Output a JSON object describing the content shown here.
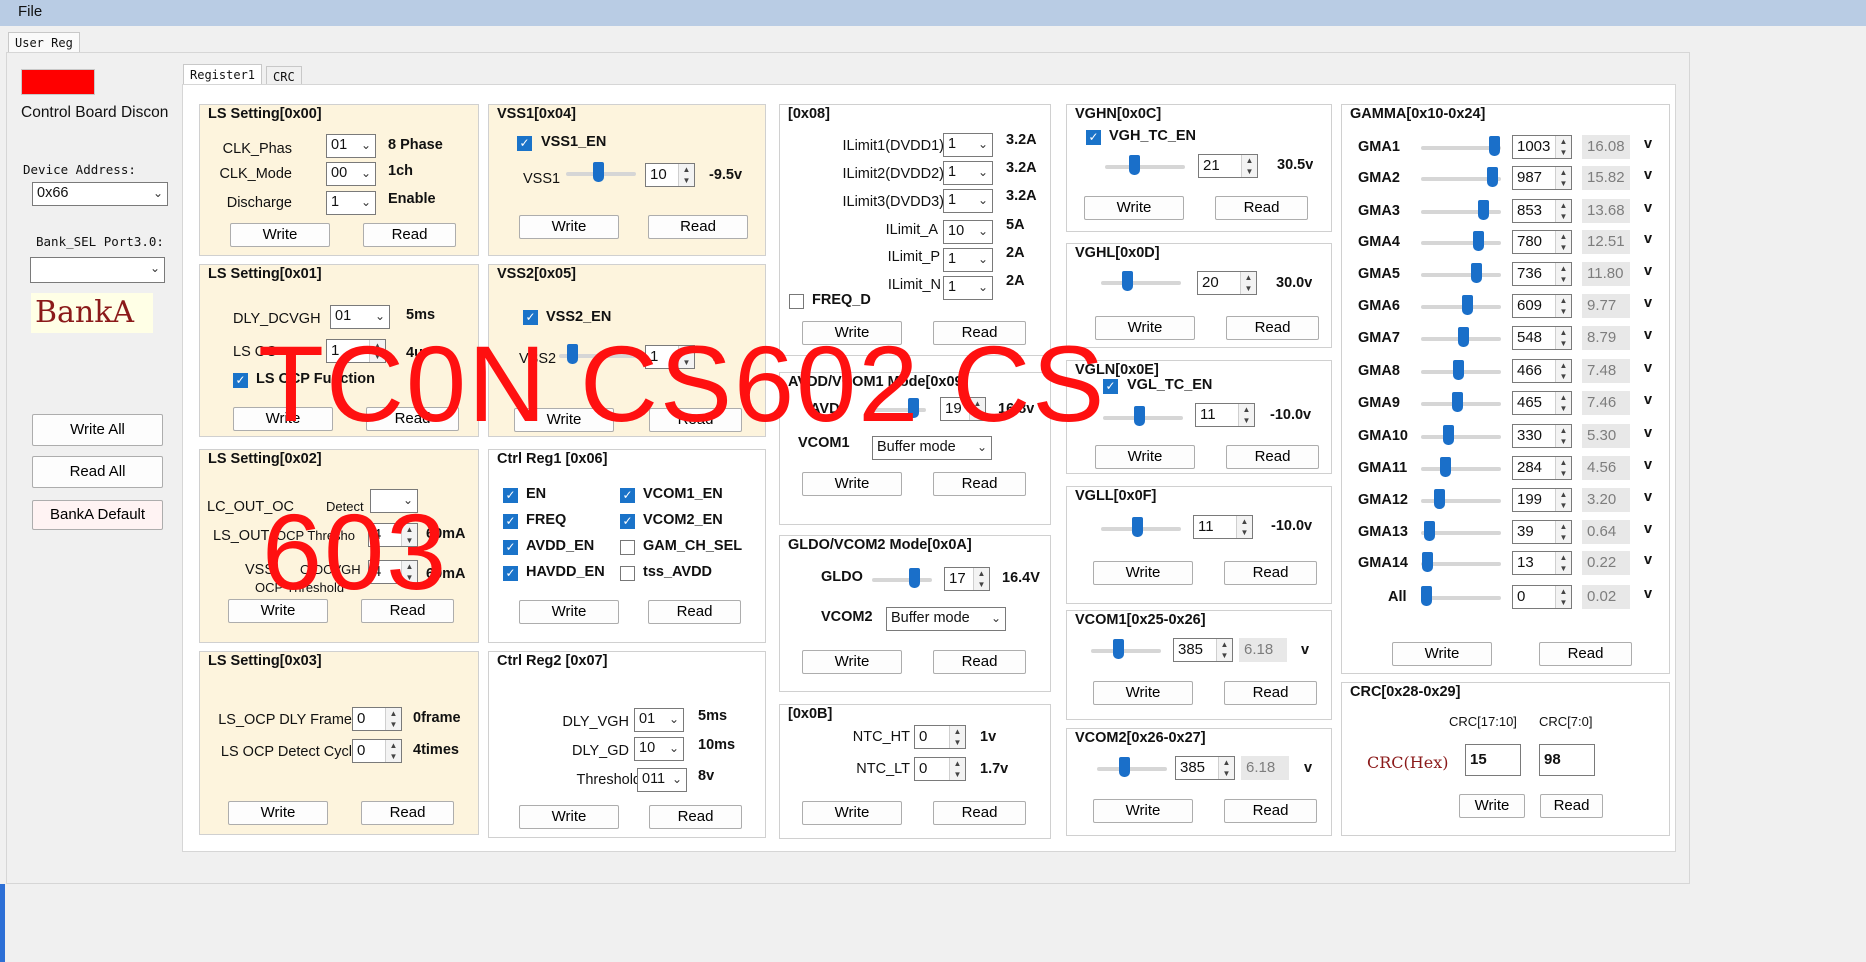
{
  "menu": {
    "file": "File"
  },
  "window": {
    "user_reg_tab": "User Reg",
    "tab_register1": "Register1",
    "tab_crc": "CRC"
  },
  "sidebar": {
    "status_text": "Control Board Discon",
    "status_color": "#ff0000",
    "device_address_label": "Device Address:",
    "device_address_value": "0x66",
    "bank_sel_label": "Bank_SEL Port3.0:",
    "bank_sel_value": "",
    "bank_name": "BankA",
    "write_all": "Write All",
    "read_all": "Read All",
    "bank_default": "BankA Default"
  },
  "buttons": {
    "write": "Write",
    "read": "Read"
  },
  "ls00": {
    "title": "LS Setting[0x00]",
    "rows": [
      {
        "label": "CLK_Phas",
        "value": "01",
        "result": "8 Phase"
      },
      {
        "label": "CLK_Mode",
        "value": "00",
        "result": "1ch"
      },
      {
        "label": "Discharge",
        "value": "1",
        "result": "Enable"
      }
    ]
  },
  "ls01": {
    "title": "LS Setting[0x01]",
    "dly_label": "DLY_DCVGH",
    "dly_value": "01",
    "dly_result": "5ms",
    "ocp_label": "LS OC",
    "ocp_value": "1",
    "ocp_result": "4u",
    "func_label": "LS OCP Function",
    "func_checked": true
  },
  "ls02": {
    "title": "LS Setting[0x02]",
    "lc_label": "LC_OUT_OC",
    "lc_label2": "Detect",
    "lc_value": "",
    "thr_label": "LS_OUT",
    "thr_label2": "OCP Thresho",
    "thr_value": "4",
    "thr_result": "60mA",
    "vss_label": "VSS",
    "vss_label2": "O/DCVGH",
    "vss_label3": "OCP Threshold",
    "vss_value": "4",
    "vss_result": "60mA"
  },
  "ls03": {
    "title": "LS Setting[0x03]",
    "rows": [
      {
        "label": "LS_OCP DLY Frame",
        "value": "0",
        "result": "0frame"
      },
      {
        "label": "LS OCP Detect Cycl",
        "value": "0",
        "result": "4times"
      }
    ]
  },
  "vss1": {
    "title": "VSS1[0x04]",
    "en_label": "VSS1_EN",
    "en_checked": true,
    "slider_label": "VSS1",
    "slider_fraction": 0.45,
    "value": "10",
    "result": "-9.5v"
  },
  "vss2": {
    "title": "VSS2[0x05]",
    "en_label": "VSS2_EN",
    "en_checked": true,
    "slider_label": "VSS2",
    "slider_fraction": 0.1,
    "value": "1",
    "result": "v"
  },
  "ctrl1": {
    "title": "Ctrl Reg1 [0x06]",
    "checks": [
      {
        "label": "EN",
        "checked": true
      },
      {
        "label": "VCOM1_EN",
        "checked": true
      },
      {
        "label": "FREQ",
        "checked": true
      },
      {
        "label": "VCOM2_EN",
        "checked": true
      },
      {
        "label": "AVDD_EN",
        "checked": true
      },
      {
        "label": "GAM_CH_SEL",
        "checked": false
      },
      {
        "label": "HAVDD_EN",
        "checked": true
      },
      {
        "label": "tss_AVDD",
        "checked": false
      }
    ]
  },
  "ctrl2": {
    "title": "Ctrl Reg2 [0x07]",
    "rows": [
      {
        "label": "DLY_VGH",
        "value": "01",
        "result": "5ms"
      },
      {
        "label": "DLY_GD",
        "value": "10",
        "result": "10ms"
      },
      {
        "label": "Threshold",
        "value": "011",
        "result": "8v"
      }
    ]
  },
  "r08": {
    "title": "[0x08]",
    "rows": [
      {
        "label": "ILimit1(DVDD1)",
        "value": "1",
        "result": "3.2A"
      },
      {
        "label": "ILimit2(DVDD2)",
        "value": "1",
        "result": "3.2A"
      },
      {
        "label": "ILimit3(DVDD3)",
        "value": "1",
        "result": "3.2A"
      },
      {
        "label": "ILimit_A",
        "value": "10",
        "result": "5A"
      },
      {
        "label": "ILimit_P",
        "value": "1",
        "result": "2A"
      },
      {
        "label": "ILimit_N",
        "value": "1",
        "result": "2A"
      }
    ],
    "freq_label": "FREQ_D",
    "freq_checked": false
  },
  "r09": {
    "title": "AVDD/VCOM1 Mode[0x09]",
    "avdd_label": "AVD",
    "avdd_value": "19",
    "avdd_result": "16.8v",
    "avdd_fraction": 0.85,
    "vcom_label": "VCOM1",
    "vcom_value": "Buffer mode"
  },
  "r0a": {
    "title": "GLDO/VCOM2 Mode[0x0A]",
    "gldo_label": "GLDO",
    "gldo_value": "17",
    "gldo_result": "16.4V",
    "gldo_fraction": 0.75,
    "vcom_label": "VCOM2",
    "vcom_value": "Buffer mode"
  },
  "r0b": {
    "title": "[0x0B]",
    "rows": [
      {
        "label": "NTC_HT",
        "value": "0",
        "result": "1v"
      },
      {
        "label": "NTC_LT",
        "value": "0",
        "result": "1.7v"
      }
    ]
  },
  "vghn": {
    "title": "VGHN[0x0C]",
    "en_label": "VGH_TC_EN",
    "en_checked": true,
    "value": "21",
    "result": "30.5v",
    "fraction": 0.35
  },
  "vghl": {
    "title": "VGHL[0x0D]",
    "value": "20",
    "result": "30.0v",
    "fraction": 0.3
  },
  "vgln": {
    "title": "VGLN[0x0E]",
    "en_label": "VGL_TC_EN",
    "en_checked": true,
    "value": "11",
    "result": "-10.0v",
    "fraction": 0.45
  },
  "vgll": {
    "title": "VGLL[0x0F]",
    "value": "11",
    "result": "-10.0v",
    "fraction": 0.45
  },
  "vcom1": {
    "title": "VCOM1[0x25-0x26]",
    "value": "385",
    "readout": "6.18",
    "unit": "v",
    "fraction": 0.38
  },
  "vcom2": {
    "title": "VCOM2[0x26-0x27]",
    "value": "385",
    "readout": "6.18",
    "unit": "v",
    "fraction": 0.38
  },
  "gamma": {
    "title": "GAMMA[0x10-0x24]",
    "unit": "v",
    "rows": [
      {
        "label": "GMA1",
        "value": "1003",
        "volts": "16.08",
        "fraction": 0.98
      },
      {
        "label": "GMA2",
        "value": "987",
        "volts": "15.82",
        "fraction": 0.96
      },
      {
        "label": "GMA3",
        "value": "853",
        "volts": "13.68",
        "fraction": 0.83
      },
      {
        "label": "GMA4",
        "value": "780",
        "volts": "12.51",
        "fraction": 0.76
      },
      {
        "label": "GMA5",
        "value": "736",
        "volts": "11.80",
        "fraction": 0.72
      },
      {
        "label": "GMA6",
        "value": "609",
        "volts": "9.77",
        "fraction": 0.6
      },
      {
        "label": "GMA7",
        "value": "548",
        "volts": "8.79",
        "fraction": 0.54
      },
      {
        "label": "GMA8",
        "value": "466",
        "volts": "7.48",
        "fraction": 0.46
      },
      {
        "label": "GMA9",
        "value": "465",
        "volts": "7.46",
        "fraction": 0.45
      },
      {
        "label": "GMA10",
        "value": "330",
        "volts": "5.30",
        "fraction": 0.32
      },
      {
        "label": "GMA11",
        "value": "284",
        "volts": "4.56",
        "fraction": 0.28
      },
      {
        "label": "GMA12",
        "value": "199",
        "volts": "3.20",
        "fraction": 0.19
      },
      {
        "label": "GMA13",
        "value": "39",
        "volts": "0.64",
        "fraction": 0.04
      },
      {
        "label": "GMA14",
        "value": "13",
        "volts": "0.22",
        "fraction": 0.01
      },
      {
        "label": "All",
        "value": "0",
        "volts": "0.02",
        "fraction": 0.0
      }
    ]
  },
  "crc": {
    "title": "CRC[0x28-0x29]",
    "hi_label": "CRC[17:10]",
    "lo_label": "CRC[7:0]",
    "hex_label": "CRC(Hex)",
    "hi_value": "15",
    "lo_value": "98"
  },
  "watermark": {
    "line1": "TC0N  CS602  CS",
    "line2": "603",
    "color": "#ff1010"
  }
}
